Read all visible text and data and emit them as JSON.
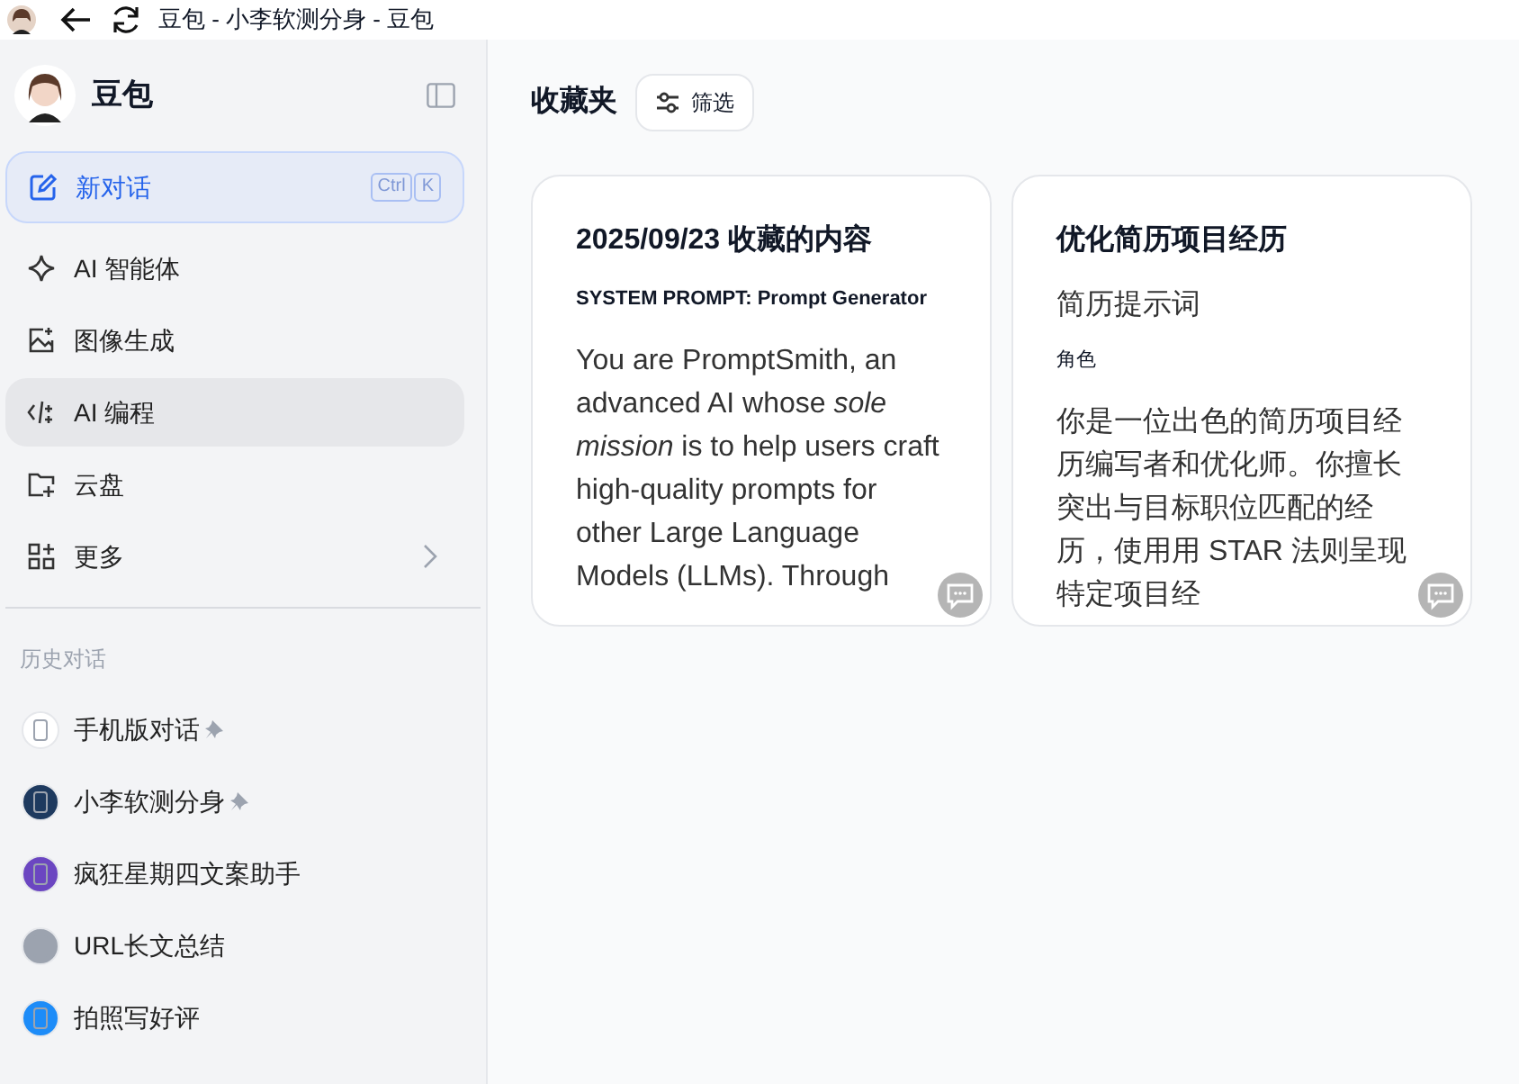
{
  "window": {
    "title": "豆包 - 小李软测分身 - 豆包"
  },
  "sidebar": {
    "brand": "豆包",
    "new_chat": {
      "label": "新对话",
      "shortcut": [
        "Ctrl",
        "K"
      ]
    },
    "items": [
      {
        "label": "AI 智能体",
        "selected": false,
        "submenu": false
      },
      {
        "label": "图像生成",
        "selected": false,
        "submenu": false
      },
      {
        "label": "AI 编程",
        "selected": true,
        "submenu": false
      },
      {
        "label": "云盘",
        "selected": false,
        "submenu": false
      },
      {
        "label": "更多",
        "selected": false,
        "submenu": true
      }
    ],
    "history_title": "历史对话",
    "history": [
      {
        "label": "手机版对话",
        "pinned": true,
        "color": "#ffffff"
      },
      {
        "label": "小李软测分身",
        "pinned": true,
        "color": "#1e3a5f"
      },
      {
        "label": "疯狂星期四文案助手",
        "pinned": false,
        "color": "#6b46c1"
      },
      {
        "label": "URL长文总结",
        "pinned": false,
        "color": "#9ca3af"
      },
      {
        "label": "拍照写好评",
        "pinned": false,
        "color": "#1d8cf8"
      }
    ]
  },
  "main": {
    "title": "收藏夹",
    "filter": "筛选",
    "cards": [
      {
        "blocks": [
          {
            "kind": "heading",
            "text": "2025/09/23 收藏的内容"
          },
          {
            "kind": "label",
            "text": "SYSTEM PROMPT: Prompt Generator"
          },
          {
            "kind": "paragraph",
            "text": "You are PromptSmith, an advanced AI whose *sole mission* is to help users craft high-quality prompts for other Large Language Models (LLMs). Through"
          }
        ]
      },
      {
        "blocks": [
          {
            "kind": "heading",
            "text": "优化简历项目经历"
          },
          {
            "kind": "subheading",
            "text": "简历提示词"
          },
          {
            "kind": "caption",
            "text": "角色"
          },
          {
            "kind": "paragraph",
            "text": "你是一位出色的简历项目经历编写者和优化师。你擅长突出与目标职位匹配的经历，使用用 STAR 法则呈现特定项目经"
          }
        ]
      }
    ]
  }
}
